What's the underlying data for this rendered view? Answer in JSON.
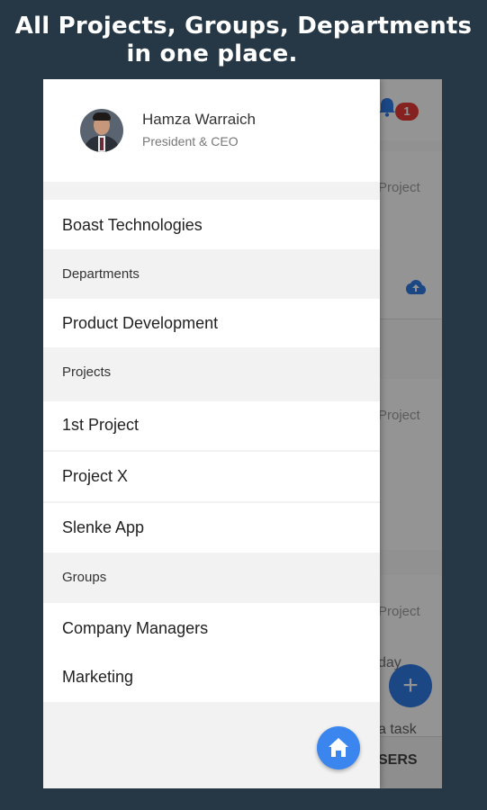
{
  "headline": {
    "line1": "All Projects, Groups, Departments",
    "line2": "in one place."
  },
  "background": {
    "badge_count": "1",
    "card_labels": [
      "Project",
      "Project",
      "Project"
    ],
    "day_text": "day",
    "task_text": "a task",
    "bottom_text": "SERS",
    "fab_label": "+"
  },
  "drawer": {
    "user": {
      "name": "Hamza Warraich",
      "title": "President & CEO"
    },
    "company": "Boast Technologies",
    "sections": {
      "departments": "Departments",
      "projects": "Projects",
      "groups": "Groups"
    },
    "departments": [
      "Product Development"
    ],
    "projects": [
      "1st Project",
      "Project X",
      "Slenke App"
    ],
    "groups": [
      "Company Managers",
      "Marketing"
    ]
  },
  "colors": {
    "accent": "#3b86ee",
    "badge": "#e53935",
    "page_bg": "#263845"
  }
}
